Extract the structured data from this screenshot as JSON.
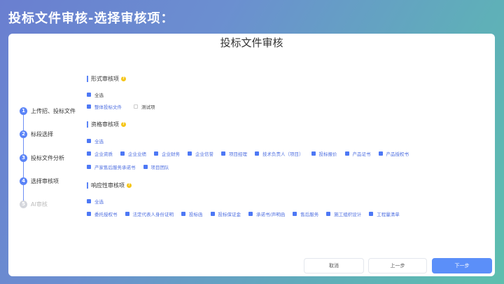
{
  "page_heading": "投标文件审核-选择审核项：",
  "card_title": "投标文件审核",
  "steps": [
    {
      "num": "1",
      "label": "上传招、投标文件",
      "active": true
    },
    {
      "num": "2",
      "label": "标段选择",
      "active": true
    },
    {
      "num": "3",
      "label": "投标文件分析",
      "active": true
    },
    {
      "num": "4",
      "label": "选择审核项",
      "active": true
    },
    {
      "num": "5",
      "label": "AI审核",
      "active": false
    }
  ],
  "sections": {
    "formal": {
      "title": "形式审核项",
      "select_all": "全选",
      "items": [
        {
          "label": "整体投标文件",
          "checked": true
        },
        {
          "label": "测试项",
          "checked": false
        }
      ]
    },
    "qualification": {
      "title": "资格审核项",
      "select_all": "全选",
      "items_row1": [
        "企业资质",
        "企业业绩",
        "企业财务",
        "企业信誉",
        "项目经理",
        "技术负责人（项目）",
        "投标报价",
        "产品证书",
        "产品授权书"
      ],
      "items_row2": [
        "产家售后服务承诺书",
        "项目团队"
      ]
    },
    "responsiveness": {
      "title": "响应性审核项",
      "select_all": "全选",
      "items": [
        "委托授权书",
        "法定代表人身份证明",
        "投标函",
        "投标保证金",
        "承诺书/声明函",
        "售后服务",
        "施工组织设计",
        "工程量清单"
      ]
    }
  },
  "buttons": {
    "cancel": "取消",
    "prev": "上一步",
    "next": "下一步"
  },
  "colors": {
    "accent": "#5b84f7",
    "help_icon": "#f5c518"
  }
}
